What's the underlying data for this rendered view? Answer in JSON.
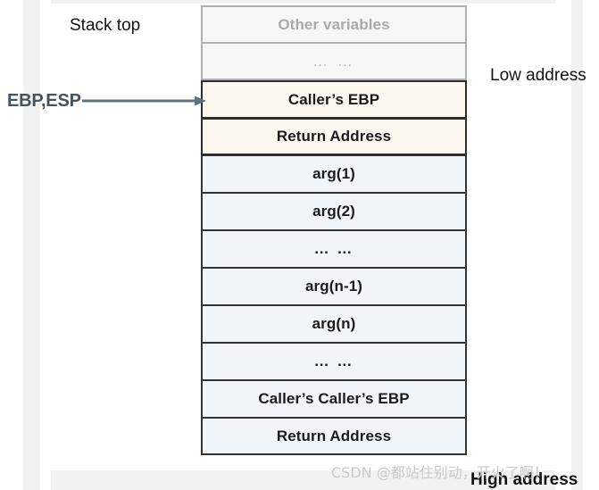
{
  "diagram": {
    "title_labels": {
      "stack_top": "Stack top",
      "low_address": "Low address",
      "high_address": "High address"
    },
    "pointer": {
      "label": "EBP,ESP",
      "color": "#44545f",
      "icon": "arrow-right-icon"
    },
    "colors": {
      "faded_fill": "#f6f6f6",
      "faded_border": "#b0b0b0",
      "faded_text": "#aaaaaa",
      "cream_fill": "#fdf8ef",
      "blue_fill": "#f0f5f9",
      "dark_border": "#2e2e2e",
      "text": "#1c1c1c",
      "page_bg": "#f2f2f2",
      "panel_bg": "#ffffff"
    },
    "stack_rows": [
      {
        "label": "Other variables",
        "style": "faded"
      },
      {
        "label": "… …",
        "style": "faded"
      },
      {
        "label": "Caller’s EBP",
        "style": "cream"
      },
      {
        "label": "Return Address",
        "style": "cream"
      },
      {
        "label": "arg(1)",
        "style": "blue"
      },
      {
        "label": "arg(2)",
        "style": "blue"
      },
      {
        "label": "… …",
        "style": "blue"
      },
      {
        "label": "arg(n-1)",
        "style": "blue"
      },
      {
        "label": "arg(n)",
        "style": "blue"
      },
      {
        "label": "… …",
        "style": "blue"
      },
      {
        "label": "Caller’s Caller’s EBP",
        "style": "blue"
      },
      {
        "label": "Return Address",
        "style": "blue"
      }
    ]
  },
  "watermark": {
    "text": "CSDN @都站住别动，开火了啊！"
  }
}
